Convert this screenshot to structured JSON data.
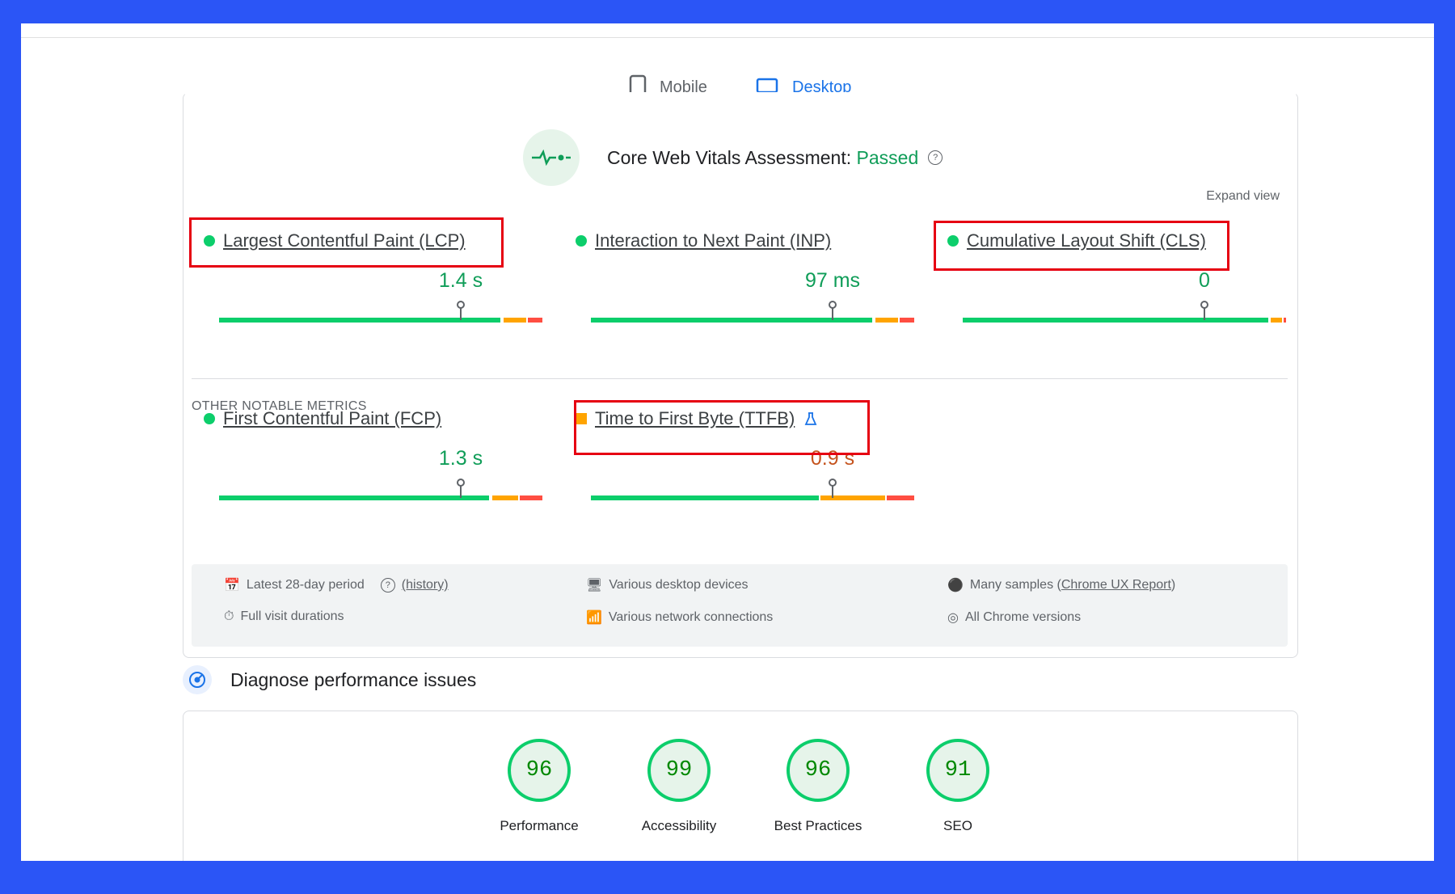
{
  "tabs": {
    "mobile": "Mobile",
    "desktop": "Desktop",
    "selected": "Desktop"
  },
  "assessment": {
    "title": "Core Web Vitals Assessment:",
    "status": "Passed",
    "expand": "Expand view"
  },
  "core_metrics": [
    {
      "label": "Largest Contentful Paint (LCP)",
      "value": "1.4 s",
      "rating": "good",
      "highlighted": true
    },
    {
      "label": "Interaction to Next Paint (INP)",
      "value": "97 ms",
      "rating": "good",
      "highlighted": false
    },
    {
      "label": "Cumulative Layout Shift (CLS)",
      "value": "0",
      "rating": "good",
      "highlighted": true
    }
  ],
  "other": {
    "heading": "OTHER NOTABLE METRICS",
    "metrics": [
      {
        "label": "First Contentful Paint (FCP)",
        "value": "1.3 s",
        "rating": "good",
        "highlighted": false
      },
      {
        "label": "Time to First Byte (TTFB)",
        "value": "0.9 s",
        "rating": "needs-improvement",
        "highlighted": true
      }
    ]
  },
  "info": {
    "period": "Latest 28-day period",
    "history": "(history)",
    "devices": "Various desktop devices",
    "samples_prefix": "Many samples (",
    "samples_link": "Chrome UX Report",
    "samples_suffix": ")",
    "durations": "Full visit durations",
    "network": "Various network connections",
    "chrome": "All Chrome versions"
  },
  "diagnose": {
    "title": "Diagnose performance issues"
  },
  "scores": [
    {
      "value": "96",
      "label": "Performance"
    },
    {
      "value": "99",
      "label": "Accessibility"
    },
    {
      "value": "96",
      "label": "Best Practices"
    },
    {
      "value": "91",
      "label": "SEO"
    }
  ],
  "colors": {
    "good": "#0cce6b",
    "average": "#ffa400",
    "poor": "#ff4e42",
    "accent": "#1a73e8",
    "frame": "#2b55f6",
    "highlight": "#e60012"
  }
}
